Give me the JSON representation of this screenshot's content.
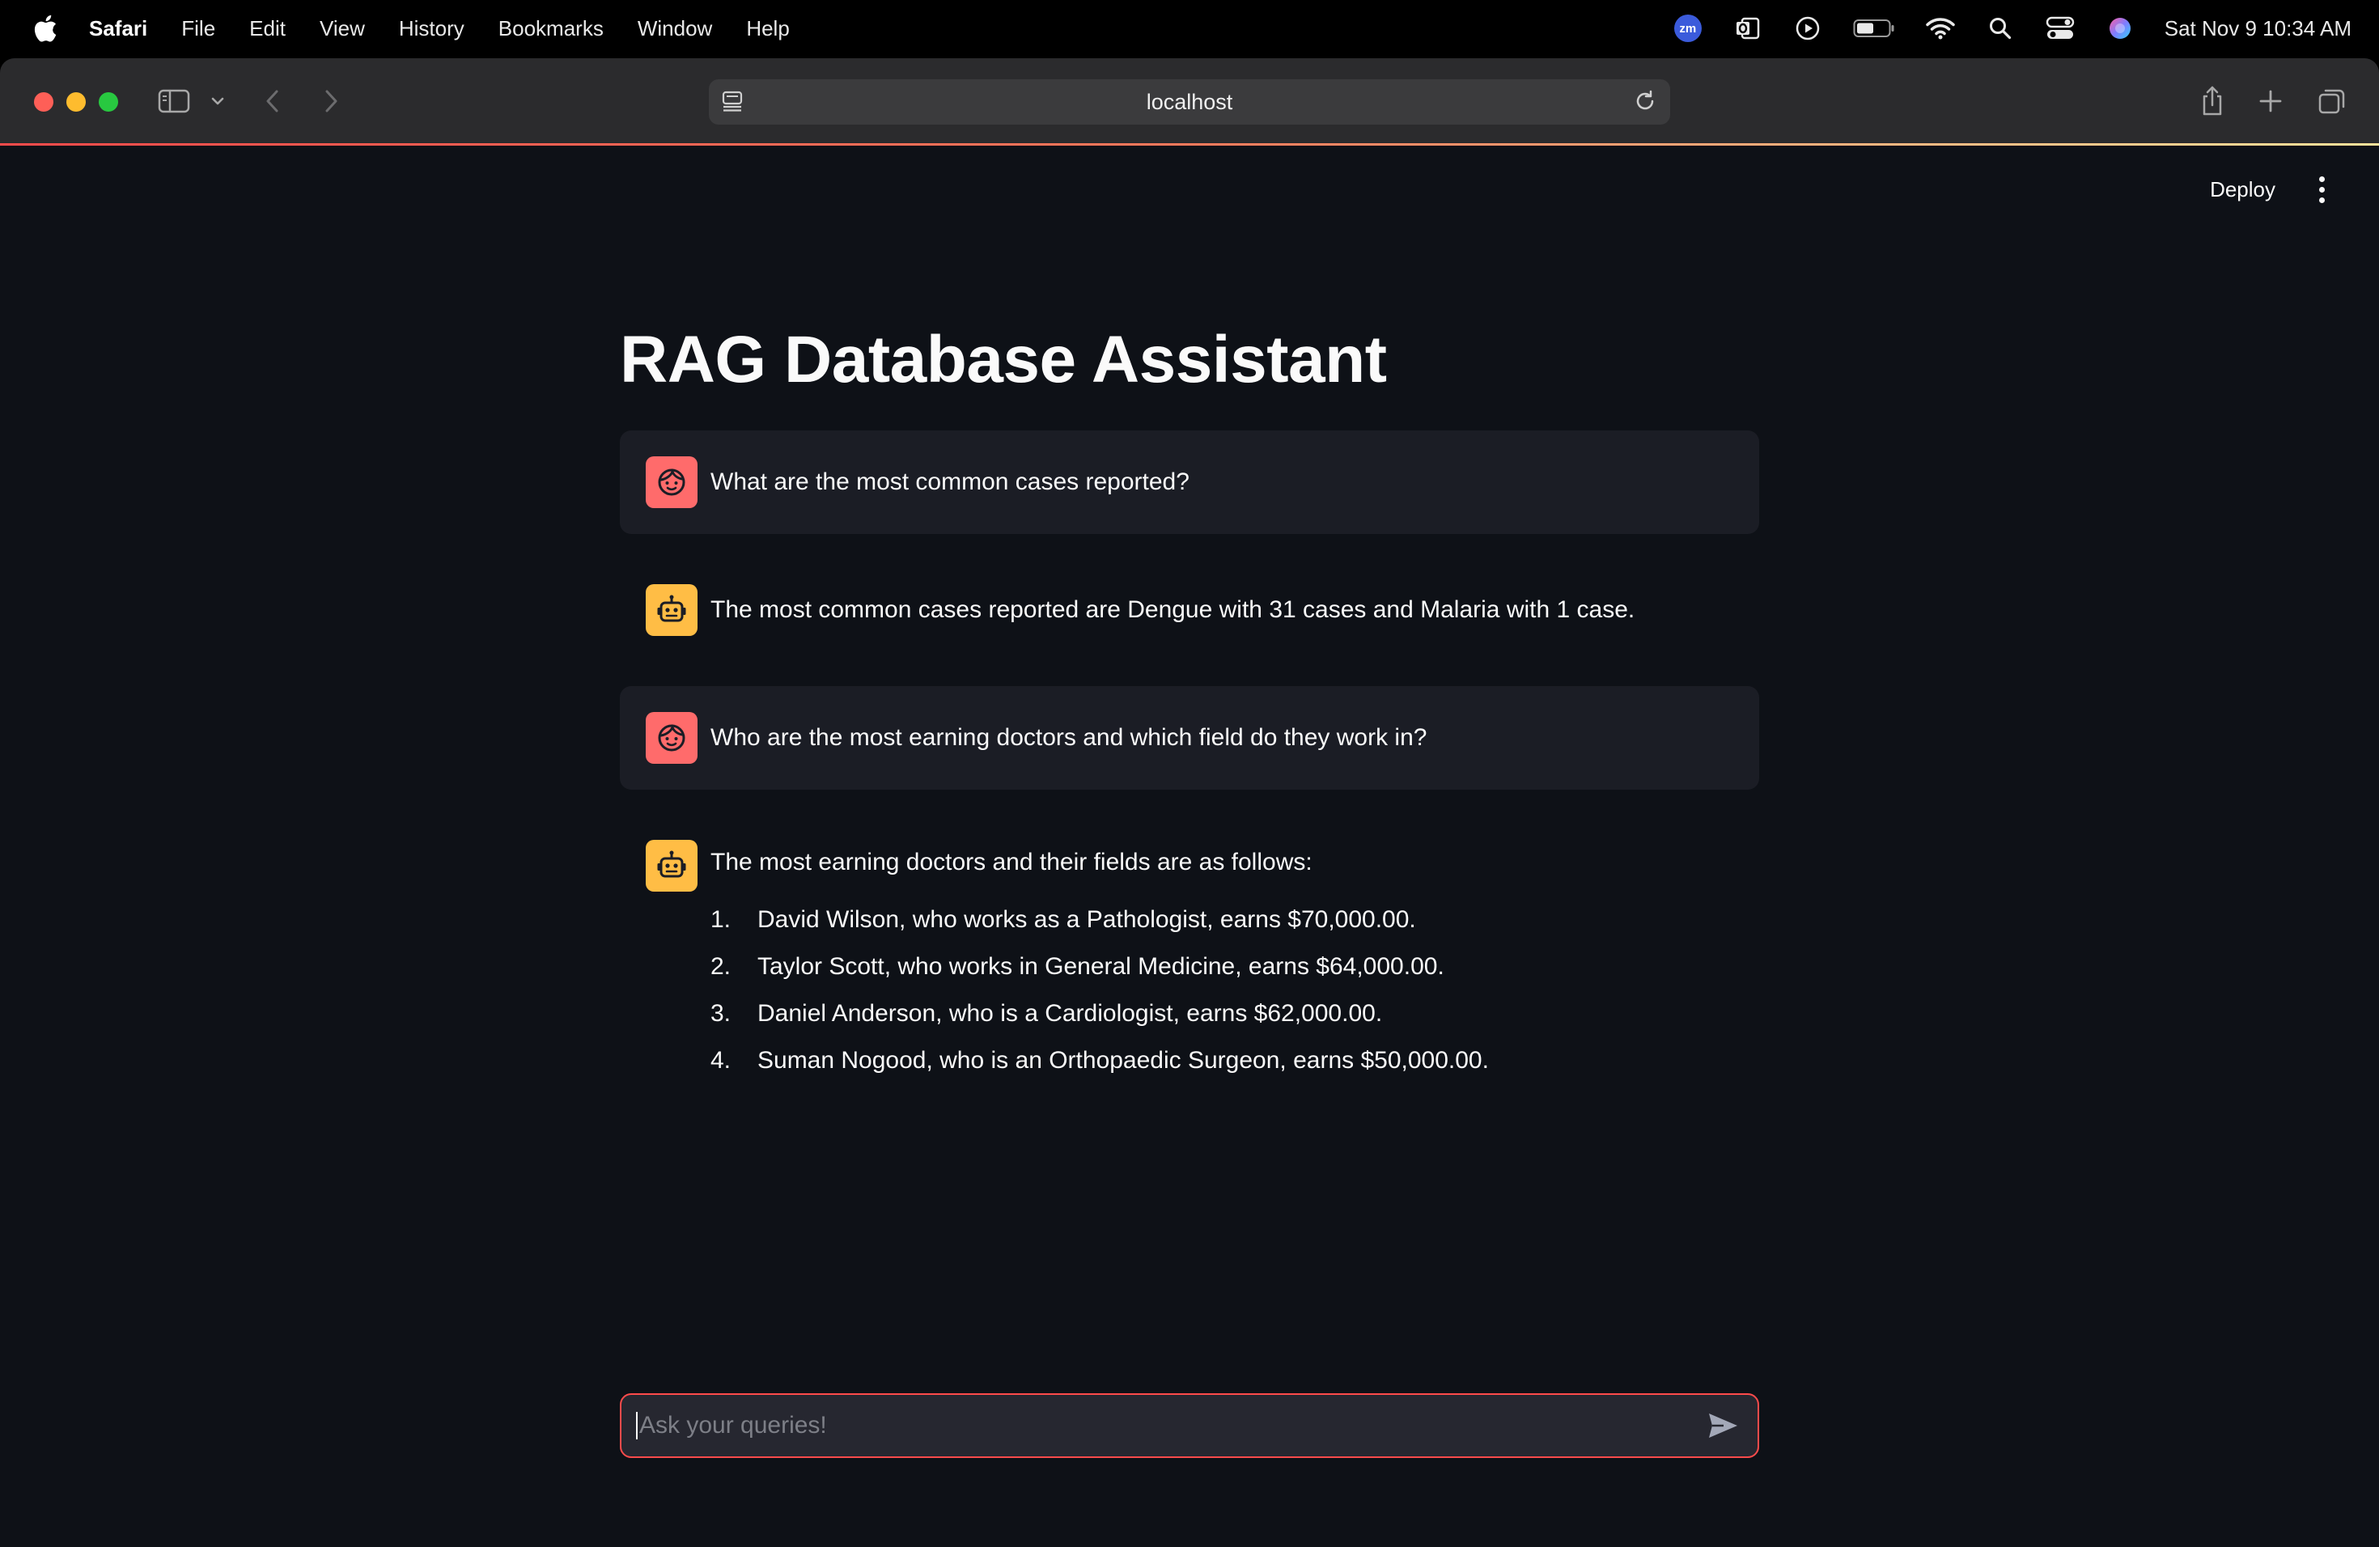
{
  "menubar": {
    "app": "Safari",
    "items": [
      "File",
      "Edit",
      "View",
      "History",
      "Bookmarks",
      "Window",
      "Help"
    ],
    "status_icons": [
      "zoom-icon",
      "outlook-icon",
      "play-icon",
      "battery-icon",
      "wifi-icon",
      "spotlight-search-icon",
      "control-center-icon",
      "siri-icon"
    ],
    "zoom_badge": "zm",
    "clock": "Sat Nov 9  10:34 AM"
  },
  "browser": {
    "url": "localhost"
  },
  "app": {
    "deploy_label": "Deploy",
    "title": "RAG Database Assistant",
    "messages": [
      {
        "role": "user",
        "text": "What are the most common cases reported?"
      },
      {
        "role": "assistant",
        "text": "The most common cases reported are Dengue with 31 cases and Malaria with 1 case."
      },
      {
        "role": "user",
        "text": "Who are the most earning doctors and which field do they work in?"
      },
      {
        "role": "assistant",
        "text": "The most earning doctors and their fields are as follows:",
        "list": [
          {
            "num": "1.",
            "text": "David Wilson, who works as a Pathologist, earns $70,000.00."
          },
          {
            "num": "2.",
            "text": "Taylor Scott, who works in General Medicine, earns $64,000.00."
          },
          {
            "num": "3.",
            "text": "Daniel Anderson, who is a Cardiologist, earns $62,000.00."
          },
          {
            "num": "4.",
            "text": "Suman Nogood, who is an Orthopaedic Surgeon, earns $50,000.00."
          }
        ]
      }
    ],
    "chat_input": {
      "placeholder": "Ask your queries!",
      "value": ""
    }
  },
  "colors": {
    "background": "#0e1117",
    "user_avatar": "#ff6b6b",
    "assistant_avatar": "#ffbd45",
    "accent": "#ff4b4b"
  }
}
